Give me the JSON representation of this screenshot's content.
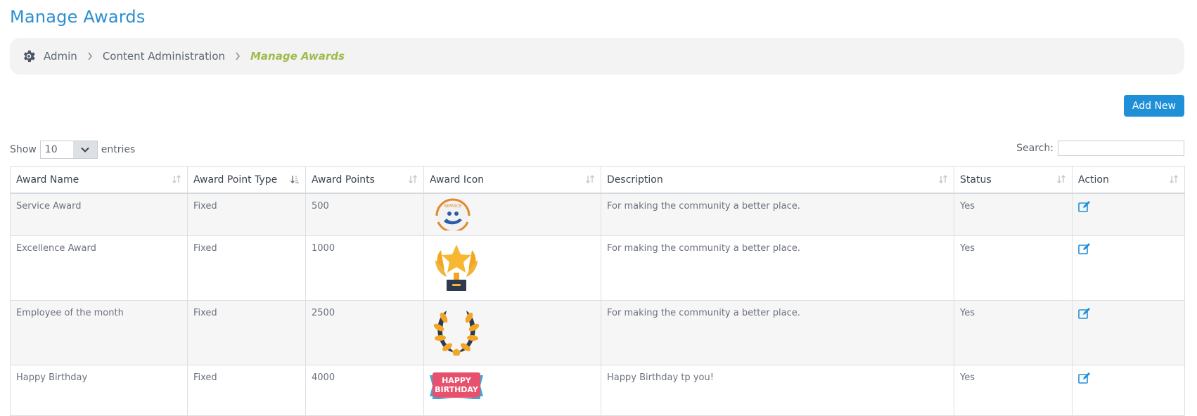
{
  "page": {
    "title": "Manage Awards"
  },
  "breadcrumb": {
    "items": [
      {
        "label": "Admin"
      },
      {
        "label": "Content Administration"
      },
      {
        "label": "Manage Awards"
      }
    ]
  },
  "toolbar": {
    "add_new_label": "Add New"
  },
  "entries": {
    "show_label": "Show",
    "selected": "10",
    "entries_label": "entries"
  },
  "search": {
    "label": "Search:",
    "value": ""
  },
  "table": {
    "columns": [
      "Award Name",
      "Award Point Type",
      "Award Points",
      "Award Icon",
      "Description",
      "Status",
      "Action"
    ],
    "rows": [
      {
        "name": "Service Award",
        "point_type": "Fixed",
        "points": "500",
        "icon": "service-award-icon",
        "description": "For making the community a better place.",
        "status": "Yes"
      },
      {
        "name": "Excellence Award",
        "point_type": "Fixed",
        "points": "1000",
        "icon": "trophy-icon",
        "description": "For making the community a better place.",
        "status": "Yes"
      },
      {
        "name": "Employee of the month",
        "point_type": "Fixed",
        "points": "2500",
        "icon": "laurel-wreath-icon",
        "description": "For making the community a better place.",
        "status": "Yes"
      },
      {
        "name": "Happy Birthday",
        "point_type": "Fixed",
        "points": "4000",
        "icon": "birthday-banner-icon",
        "description": "Happy Birthday tp you!",
        "status": "Yes"
      }
    ]
  },
  "icon_text": {
    "service": "SERVICE",
    "birthday_line1": "HAPPY",
    "birthday_line2": "BIRTHDAY"
  },
  "colors": {
    "accent": "#1f8fd8",
    "title": "#2d8fd0",
    "breadcrumb_active": "#9fbb4c"
  }
}
